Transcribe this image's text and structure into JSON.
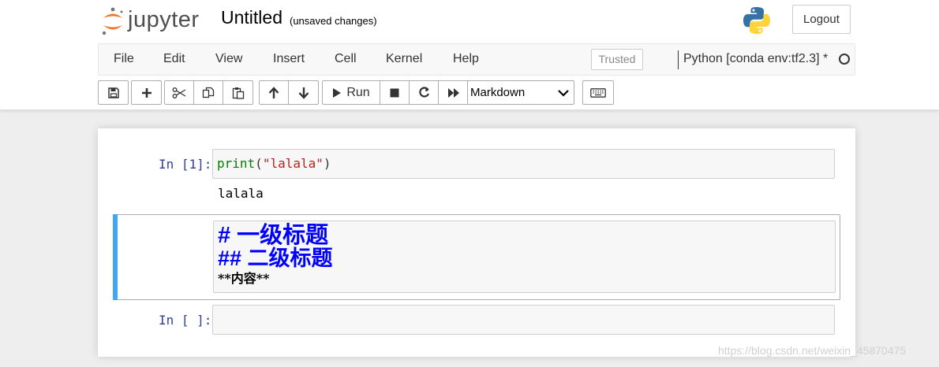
{
  "header": {
    "logo_text": "jupyter",
    "notebook_title": "Untitled",
    "save_status": "(unsaved changes)",
    "logout_label": "Logout"
  },
  "menubar": {
    "items": [
      "File",
      "Edit",
      "View",
      "Insert",
      "Cell",
      "Kernel",
      "Help"
    ],
    "trusted_label": "Trusted",
    "kernel_name": "Python [conda env:tf2.3] *"
  },
  "toolbar": {
    "run_label": "Run",
    "cell_type_selected": "Markdown",
    "icons": [
      "save-icon",
      "plus-icon",
      "scissors-icon",
      "copy-icon",
      "paste-icon",
      "arrow-up-icon",
      "arrow-down-icon",
      "play-icon",
      "stop-icon",
      "restart-icon",
      "fast-forward-icon",
      "keyboard-icon"
    ]
  },
  "cells": [
    {
      "type": "code",
      "prompt": "In [1]:",
      "source": {
        "func": "print",
        "open": "(",
        "arg": "\"lalala\"",
        "close": ")"
      },
      "output": "lalala"
    },
    {
      "type": "markdown",
      "lines": [
        "# 一级标题",
        "## 二级标题",
        "**内容**"
      ]
    },
    {
      "type": "code",
      "prompt": "In [ ]:",
      "source": ""
    }
  ],
  "watermark": "https://blog.csdn.net/weixin_45870475",
  "colors": {
    "prompt": "#303f9f",
    "selected_bar": "#42a5f5",
    "keyword": "#008000",
    "string": "#ba2121",
    "markdown_heading": "#0000ff"
  }
}
